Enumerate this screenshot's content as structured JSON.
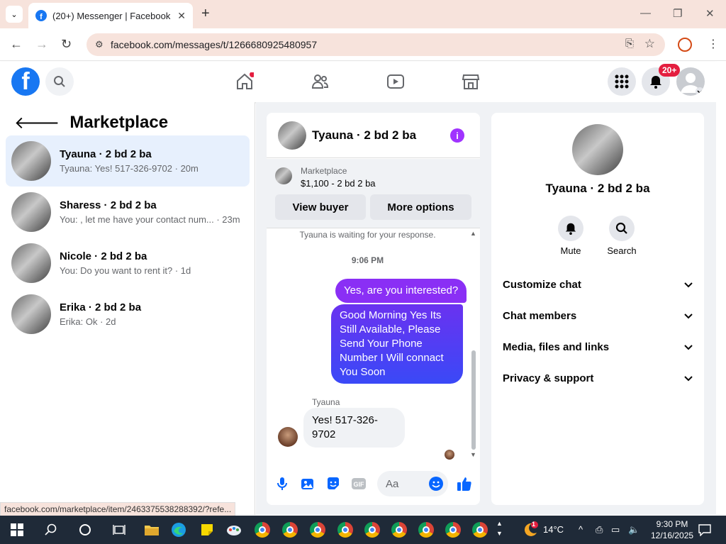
{
  "browser": {
    "tab_title": "(20+) Messenger | Facebook",
    "url": "facebook.com/messages/t/1266680925480957",
    "status_url": "facebook.com/marketplace/item/2463375538288392/?refe..."
  },
  "fb_header": {
    "notif_badge": "20+"
  },
  "left_panel": {
    "title": "Marketplace",
    "conversations": [
      {
        "name": "Tyauna · 2 bd 2 ba",
        "preview": "Tyauna: Yes! 517-326-9702 · 20m",
        "active": true
      },
      {
        "name": "Sharess · 2 bd 2 ba",
        "preview": "You: , let me have your contact num... · 23m",
        "active": false
      },
      {
        "name": "Nicole · 2 bd 2 ba",
        "preview": "You: Do you want to rent it? · 1d",
        "active": false
      },
      {
        "name": "Erika · 2 bd 2 ba",
        "preview": "Erika: Ok · 2d",
        "active": false
      }
    ]
  },
  "chat": {
    "header_name": "Tyauna · 2 bd 2 ba",
    "info_icon": "i",
    "marketplace_label": "Marketplace",
    "listing": "$1,100 - 2 bd 2 ba",
    "view_buyer": "View buyer",
    "more_options": "More options",
    "system_message": "Tyauna is waiting for your response.",
    "timestamp": "9:06 PM",
    "messages": [
      {
        "from": "me",
        "text": "Yes, are you interested?"
      },
      {
        "from": "me",
        "text": "Good Morning Yes Its Still Available, Please Send Your Phone Number I Will connact You Soon"
      },
      {
        "from": "Tyauna",
        "sender_label": "Tyauna",
        "text": "Yes! 517-326-9702"
      }
    ],
    "composer_placeholder": "Aa"
  },
  "right_panel": {
    "name": "Tyauna · 2 bd 2 ba",
    "mute_label": "Mute",
    "search_label": "Search",
    "sections": [
      "Customize chat",
      "Chat members",
      "Media, files and links",
      "Privacy & support"
    ]
  },
  "taskbar": {
    "temperature": "14°C",
    "weather_badge": "1",
    "time": "9:30 PM",
    "date": "12/16/2025"
  },
  "colors": {
    "fb_blue": "#1877f2",
    "outgoing_purple": "#8a2ff5",
    "outgoing_blue": "#3a49f7",
    "active_row": "#e7f0fd",
    "badge_red": "#e41e3f"
  }
}
